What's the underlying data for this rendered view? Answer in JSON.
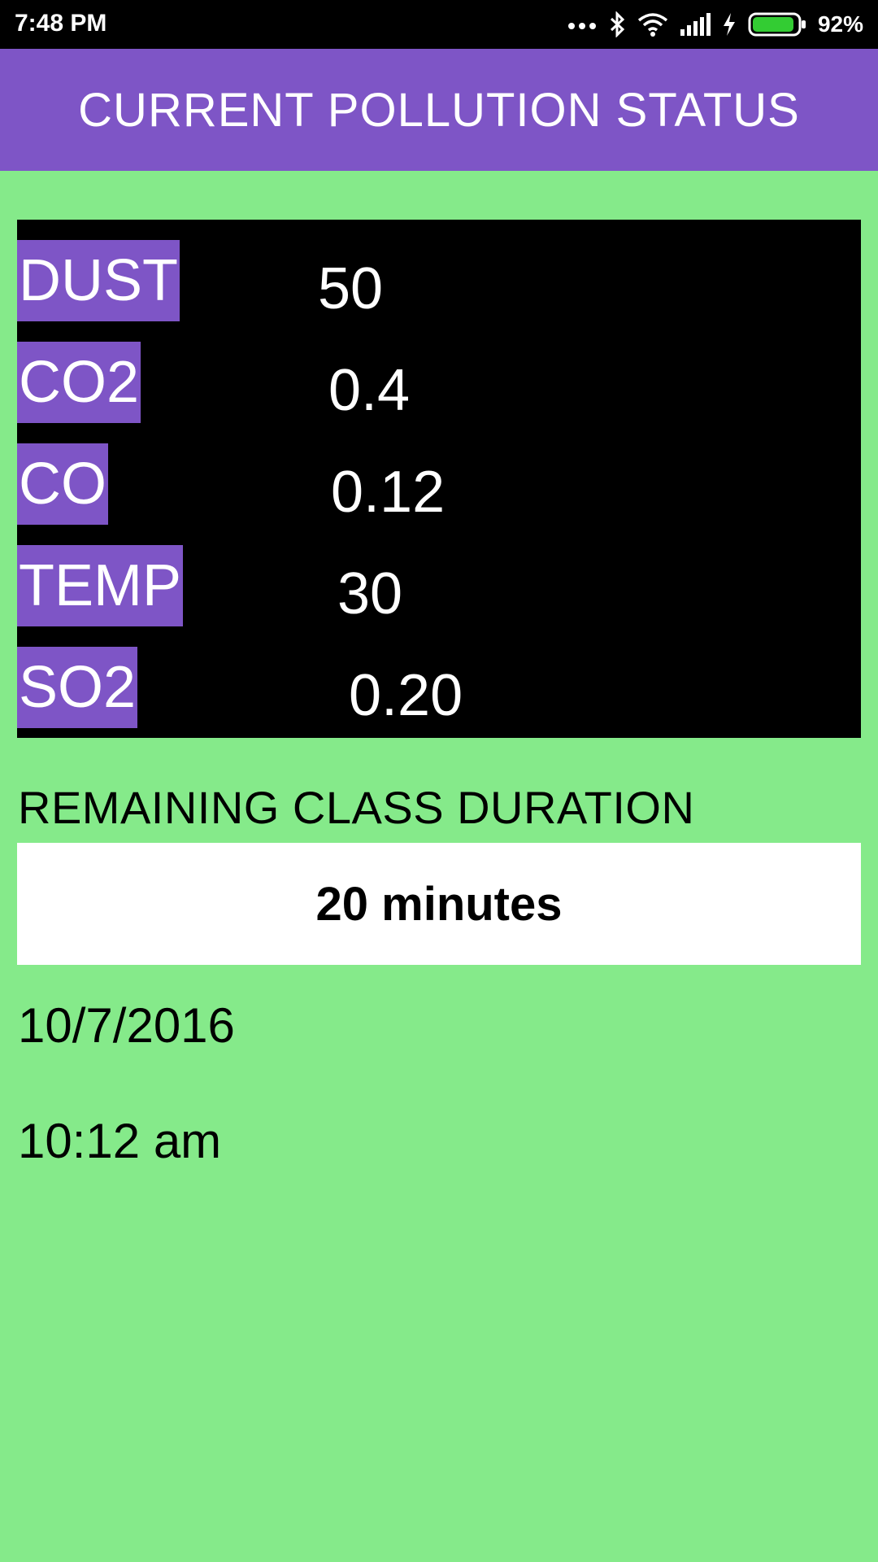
{
  "status_bar": {
    "time": "7:48 PM",
    "battery_percent": "92%",
    "icons": [
      "more-dots-icon",
      "bluetooth-icon",
      "wifi-icon",
      "signal-icon",
      "charging-icon",
      "battery-icon"
    ],
    "battery_level": 0.92,
    "battery_color": "#33cc33"
  },
  "app_bar": {
    "title": "CURRENT POLLUTION STATUS",
    "color": "#7e55c6"
  },
  "readings": [
    {
      "label": "DUST",
      "value": "50"
    },
    {
      "label": "CO2",
      "value": "0.4"
    },
    {
      "label": "CO",
      "value": "0.12"
    },
    {
      "label": "TEMP",
      "value": "30"
    },
    {
      "label": "SO2",
      "value": "0.20"
    }
  ],
  "duration": {
    "title": "REMAINING CLASS DURATION",
    "value": "20 minutes"
  },
  "date": "10/7/2016",
  "time": "10:12 am",
  "colors": {
    "background": "#85ea8a",
    "accent": "#7e55c6",
    "panel": "#000000"
  }
}
